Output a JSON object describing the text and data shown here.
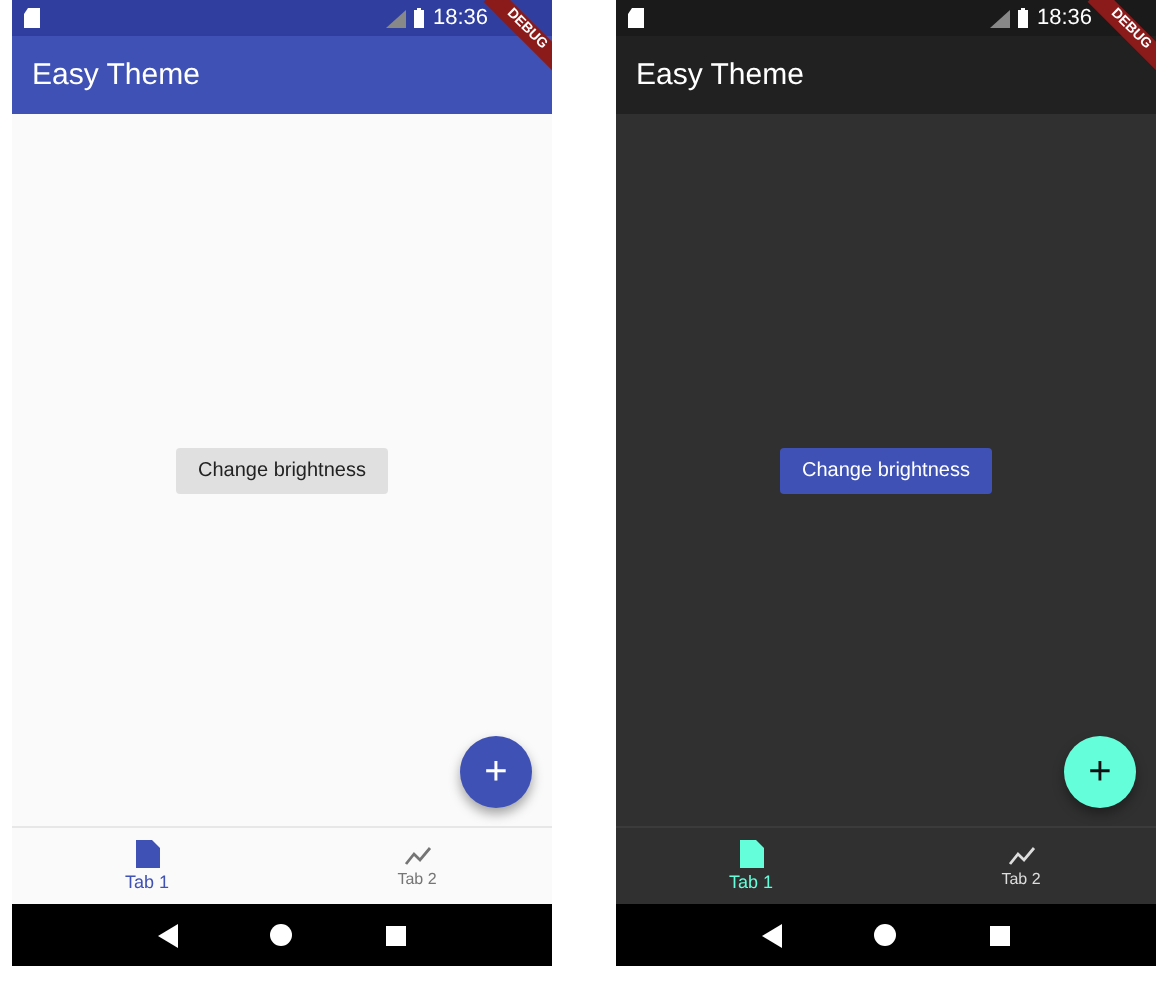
{
  "screens": [
    {
      "kind": "light",
      "status_bar": {
        "time": "18:36"
      },
      "app_bar": {
        "title": "Easy Theme"
      },
      "debug_banner": "DEBUG",
      "button": "Change brightness",
      "fab": "+",
      "tabs": [
        {
          "label": "Tab 1",
          "kind": "document",
          "selected": true
        },
        {
          "label": "Tab 2",
          "kind": "trend",
          "selected": false
        }
      ]
    },
    {
      "kind": "dark",
      "status_bar": {
        "time": "18:36"
      },
      "app_bar": {
        "title": "Easy Theme"
      },
      "debug_banner": "DEBUG",
      "button": "Change brightness",
      "fab": "+",
      "tabs": [
        {
          "label": "Tab 1",
          "kind": "document",
          "selected": true
        },
        {
          "label": "Tab 2",
          "kind": "trend",
          "selected": false
        }
      ]
    }
  ]
}
